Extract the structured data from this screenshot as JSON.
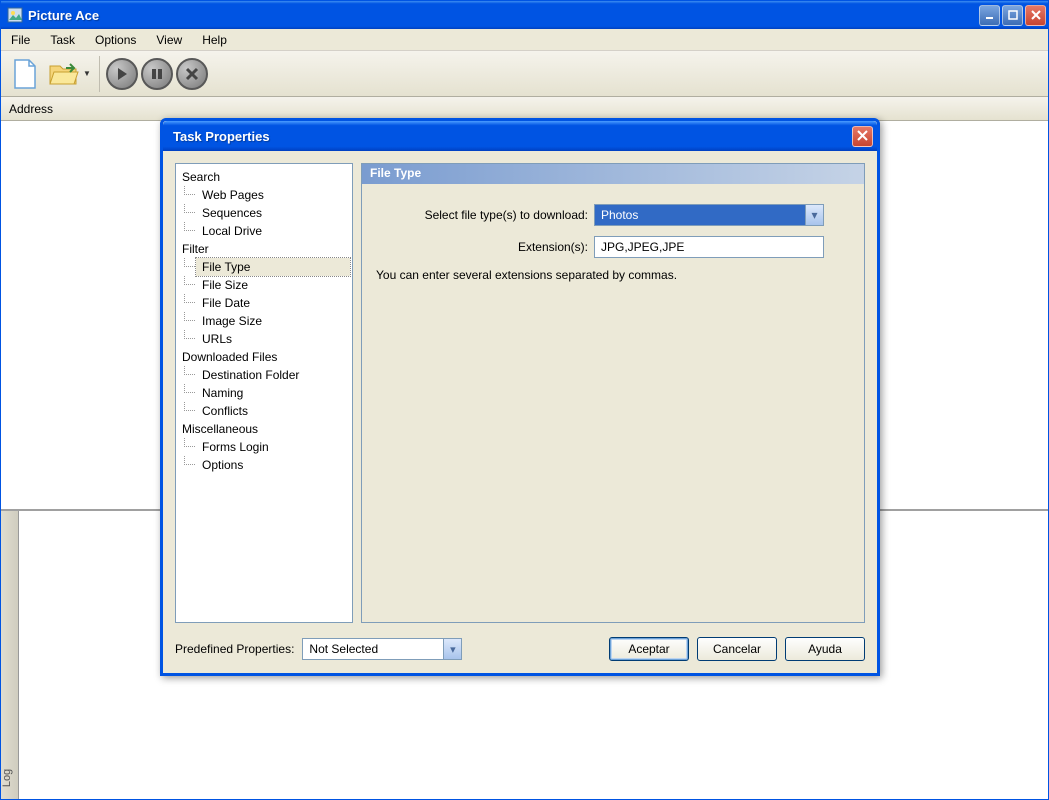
{
  "mainWindow": {
    "title": "Picture Ace",
    "menubar": [
      "File",
      "Task",
      "Options",
      "View",
      "Help"
    ],
    "addressLabel": "Address",
    "logTab": "Log"
  },
  "dialog": {
    "title": "Task Properties",
    "tree": {
      "cat1": "Search",
      "cat1_items": [
        "Web Pages",
        "Sequences",
        "Local Drive"
      ],
      "cat2": "Filter",
      "cat2_items": [
        "File Type",
        "File Size",
        "File Date",
        "Image Size",
        "URLs"
      ],
      "cat3": "Downloaded Files",
      "cat3_items": [
        "Destination Folder",
        "Naming",
        "Conflicts"
      ],
      "cat4": "Miscellaneous",
      "cat4_items": [
        "Forms Login",
        "Options"
      ]
    },
    "panel": {
      "header": "File Type",
      "selectLabel": "Select file type(s) to download:",
      "selectValue": "Photos",
      "extLabel": "Extension(s):",
      "extValue": "JPG,JPEG,JPE",
      "hint": "You can enter several extensions separated by commas."
    },
    "footer": {
      "predefLabel": "Predefined Properties:",
      "predefValue": "Not Selected",
      "accept": "Aceptar",
      "cancel": "Cancelar",
      "help": "Ayuda"
    }
  }
}
